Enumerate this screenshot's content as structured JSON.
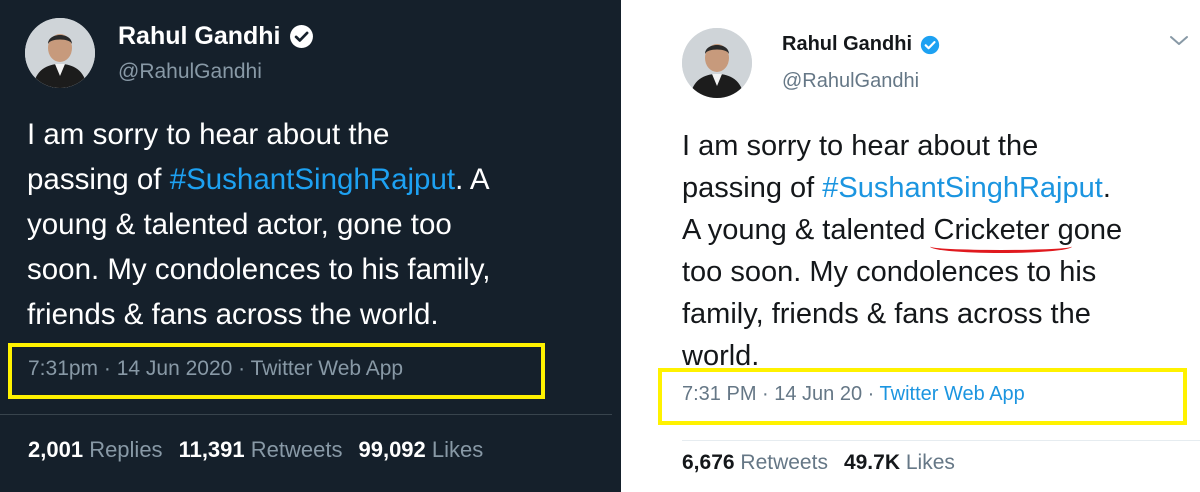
{
  "left_tweet": {
    "display_name": "Rahul Gandhi",
    "handle": "@RahulGandhi",
    "text_before": "I am sorry to hear about the",
    "text_passing": "passing of ",
    "hashtag": "#SushantSinghRajput",
    "text_after_hashtag": ". A",
    "line3": "young & talented actor, gone too",
    "line4": "soon. My condolences to his family,",
    "line5": "friends & fans across the world.",
    "timestamp": "7:31pm · 14 Jun 2020 · Twitter Web App",
    "stats": [
      {
        "count": "2,001",
        "label": "Replies"
      },
      {
        "count": "11,391",
        "label": "Retweets"
      },
      {
        "count": "99,092",
        "label": "Likes"
      }
    ],
    "theme": {
      "background": "#15202b",
      "accent": "#1da1f2"
    }
  },
  "right_tweet": {
    "display_name": "Rahul Gandhi",
    "handle": "@RahulGandhi",
    "line1": "I am sorry to hear about the",
    "line2_prefix": "passing of ",
    "hashtag": "#SushantSinghRajput",
    "line2_suffix": ".",
    "line3_prefix": "A young & talented ",
    "marked_word": "Cricketer",
    "line3_suffix": " gone",
    "line4": "too soon. My condolences to his",
    "line5": "family, friends & fans across the",
    "line6": "world.",
    "timestamp_prefix": "7:31 PM · 14 Jun 20 · ",
    "source": "Twitter Web App",
    "stats": [
      {
        "count": "6,676",
        "label": "Retweets"
      },
      {
        "count": "49.7K",
        "label": "Likes"
      }
    ],
    "theme": {
      "background": "#ffffff",
      "accent": "#1b95e0"
    }
  },
  "annotations": {
    "highlight_color": "#fff200",
    "underline_color": "#e0191e"
  },
  "icons": [
    "verified-badge-icon",
    "chevron-down-icon"
  ]
}
